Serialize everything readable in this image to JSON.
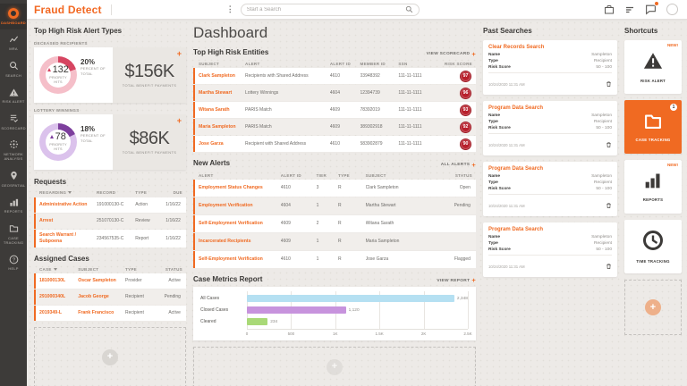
{
  "app": {
    "title": "Fraud Detect"
  },
  "icons": {
    "add": "+",
    "kebab": "⋮"
  },
  "topbar": {
    "search_placeholder": "Start a Search"
  },
  "sidebar": {
    "items": [
      {
        "label": "DASHBOARD"
      },
      {
        "label": "MRA"
      },
      {
        "label": "SEARCH"
      },
      {
        "label": "RISK ALERT"
      },
      {
        "label": "SCORECARD"
      },
      {
        "label": "NETWORK ANALYSIS"
      },
      {
        "label": "GEOSPATIAL"
      },
      {
        "label": "REPORTS"
      },
      {
        "label": "CASE TRACKING"
      },
      {
        "label": "HELP"
      }
    ]
  },
  "alert_types": {
    "title": "Top High Risk Alert Types",
    "cards": [
      {
        "label": "DECEASED RECIPIENTS",
        "hits": "132",
        "hits_label": "PRIORITY HITS",
        "percent": 20,
        "percent_text": "20%",
        "percent_label": "PERCENT OF TOTAL",
        "amount": "$156K",
        "amount_label": "TOTAL BENEFIT PAYMENTS",
        "arc_color": "#d64561",
        "ring_color": "#f5bfc9"
      },
      {
        "label": "LOTTERY WINNINGS",
        "hits": "78",
        "hits_label": "PRIORITY HITS",
        "percent": 18,
        "percent_text": "18%",
        "percent_label": "PERCENT OF TOTAL",
        "amount": "$86K",
        "amount_label": "TOTAL BENEFIT PAYMENTS",
        "arc_color": "#7d3f9d",
        "ring_color": "#dbc2ec"
      }
    ]
  },
  "requests": {
    "title": "Requests",
    "headers": [
      "REGARDING",
      "RECORD",
      "TYPE",
      "DUE"
    ],
    "rows": [
      {
        "regarding": "Administrative Action",
        "record": "191000130-C",
        "type": "Action",
        "due": "1/16/22"
      },
      {
        "regarding": "Arrest",
        "record": "251070130-C",
        "type": "Review",
        "due": "1/16/22"
      },
      {
        "regarding": "Search Warrant / Subpoena",
        "record": "234567535-C",
        "type": "Report",
        "due": "1/16/22"
      }
    ]
  },
  "assigned_cases": {
    "title": "Assigned Cases",
    "headers": [
      "CASE",
      "SUBJECT",
      "TYPE",
      "STATUS"
    ],
    "rows": [
      {
        "case": "181000130L",
        "subject": "Oscar Sampleton",
        "type": "Provider",
        "status": "Active"
      },
      {
        "case": "291000340L",
        "subject": "Jacob George",
        "type": "Recipient",
        "status": "Pending"
      },
      {
        "case": "2019349-L",
        "subject": "Frank Francisco",
        "type": "Recipient",
        "status": "Active"
      }
    ]
  },
  "dashboard_title": "Dashboard",
  "entities": {
    "title": "Top High Risk Entities",
    "action": "VIEW SCORECARD",
    "headers": [
      "SUBJECT",
      "ALERT",
      "ALERT ID",
      "MEMBER ID",
      "SSN",
      "RISK SCORE"
    ],
    "rows": [
      {
        "subject": "Clark Sampleton",
        "alert": "Recipients with Shared Address",
        "alert_id": "4610",
        "member_id": "03948392",
        "ssn": "111-11-1111",
        "risk_score": "97"
      },
      {
        "subject": "Martha Stewart",
        "alert": "Lottery Winnings",
        "alert_id": "4604",
        "member_id": "12394739",
        "ssn": "111-11-1111",
        "risk_score": "96"
      },
      {
        "subject": "Witana Sarath",
        "alert": "PARIS Match",
        "alert_id": "4609",
        "member_id": "78392019",
        "ssn": "111-11-1111",
        "risk_score": "93"
      },
      {
        "subject": "Maria Sampleton",
        "alert": "PARIS Match",
        "alert_id": "4609",
        "member_id": "389302918",
        "ssn": "111-11-1111",
        "risk_score": "92"
      },
      {
        "subject": "Jose Garza",
        "alert": "Recipient with Shared Address",
        "alert_id": "4610",
        "member_id": "583902879",
        "ssn": "111-11-1111",
        "risk_score": "90"
      }
    ]
  },
  "alerts": {
    "title": "New Alerts",
    "action": "ALL ALERTS",
    "headers": [
      "ALERT",
      "ALERT ID",
      "TIER",
      "TYPE",
      "SUBJECT",
      "STATUS"
    ],
    "rows": [
      {
        "alert": "Employment Status Changes",
        "alert_id": "4610",
        "tier": "3",
        "type": "R",
        "subject": "Clark Sampleton",
        "status": "Open"
      },
      {
        "alert": "Employment Verification",
        "alert_id": "4604",
        "tier": "1",
        "type": "R",
        "subject": "Martha Stewart",
        "status": "Pending"
      },
      {
        "alert": "Self-Employment Verification",
        "alert_id": "4609",
        "tier": "2",
        "type": "R",
        "subject": "Witana Sarath",
        "status": ""
      },
      {
        "alert": "Incarcerated Recipients",
        "alert_id": "4609",
        "tier": "1",
        "type": "R",
        "subject": "Maria Sampleton",
        "status": ""
      },
      {
        "alert": "Self-Employment Verification",
        "alert_id": "4610",
        "tier": "1",
        "type": "R",
        "subject": "Jose Garza",
        "status": "Flagged"
      }
    ]
  },
  "chart_data": {
    "type": "bar",
    "orientation": "horizontal",
    "title": "Case Metrics Report",
    "action": "VIEW REPORT",
    "categories": [
      "All Cases",
      "Closed Cases",
      "Cleared"
    ],
    "values": [
      2348,
      1120,
      234
    ],
    "value_labels": [
      "2,348",
      "1,120",
      "234"
    ],
    "colors": [
      "#b5e0f2",
      "#c793dd",
      "#a9d977"
    ],
    "xlim": [
      0,
      2500
    ],
    "xticks": [
      "0",
      "500",
      "1K",
      "1.5K",
      "2K",
      "2.5K"
    ],
    "grid": true,
    "legend": false
  },
  "past_searches": {
    "title": "Past Searches",
    "cards": [
      {
        "title": "Clear Records Search",
        "fields": [
          {
            "label": "Name",
            "value": "Sampleton"
          },
          {
            "label": "Type",
            "value": "Recipient"
          },
          {
            "label": "Risk Score",
            "value": "50 - 100"
          }
        ],
        "timestamp": "10/24/2020 11:31 AM"
      },
      {
        "title": "Program Data Search",
        "fields": [
          {
            "label": "Name",
            "value": "Sampleton"
          },
          {
            "label": "Type",
            "value": "Recipient"
          },
          {
            "label": "Risk Score",
            "value": "50 - 100"
          }
        ],
        "timestamp": "10/24/2020 11:31 AM"
      },
      {
        "title": "Program Data Search",
        "fields": [
          {
            "label": "Name",
            "value": "Sampleton"
          },
          {
            "label": "Type",
            "value": "Recipient"
          },
          {
            "label": "Risk Score",
            "value": "50 - 100"
          }
        ],
        "timestamp": "10/24/2020 11:31 AM"
      },
      {
        "title": "Program Data Search",
        "fields": [
          {
            "label": "Name",
            "value": "Sampleton"
          },
          {
            "label": "Type",
            "value": "Recipient"
          },
          {
            "label": "Risk Score",
            "value": "50 - 100"
          }
        ],
        "timestamp": "10/24/2020 11:31 AM"
      }
    ]
  },
  "shortcuts": {
    "title": "Shortcuts",
    "cards": [
      {
        "label": "RISK ALERT",
        "badge": "NEW!"
      },
      {
        "label": "CASE TRACKING",
        "badge": "1",
        "highlight": true
      },
      {
        "label": "REPORTS",
        "badge": "NEW!"
      },
      {
        "label": "TIME TRACKING",
        "badge": ""
      }
    ]
  }
}
